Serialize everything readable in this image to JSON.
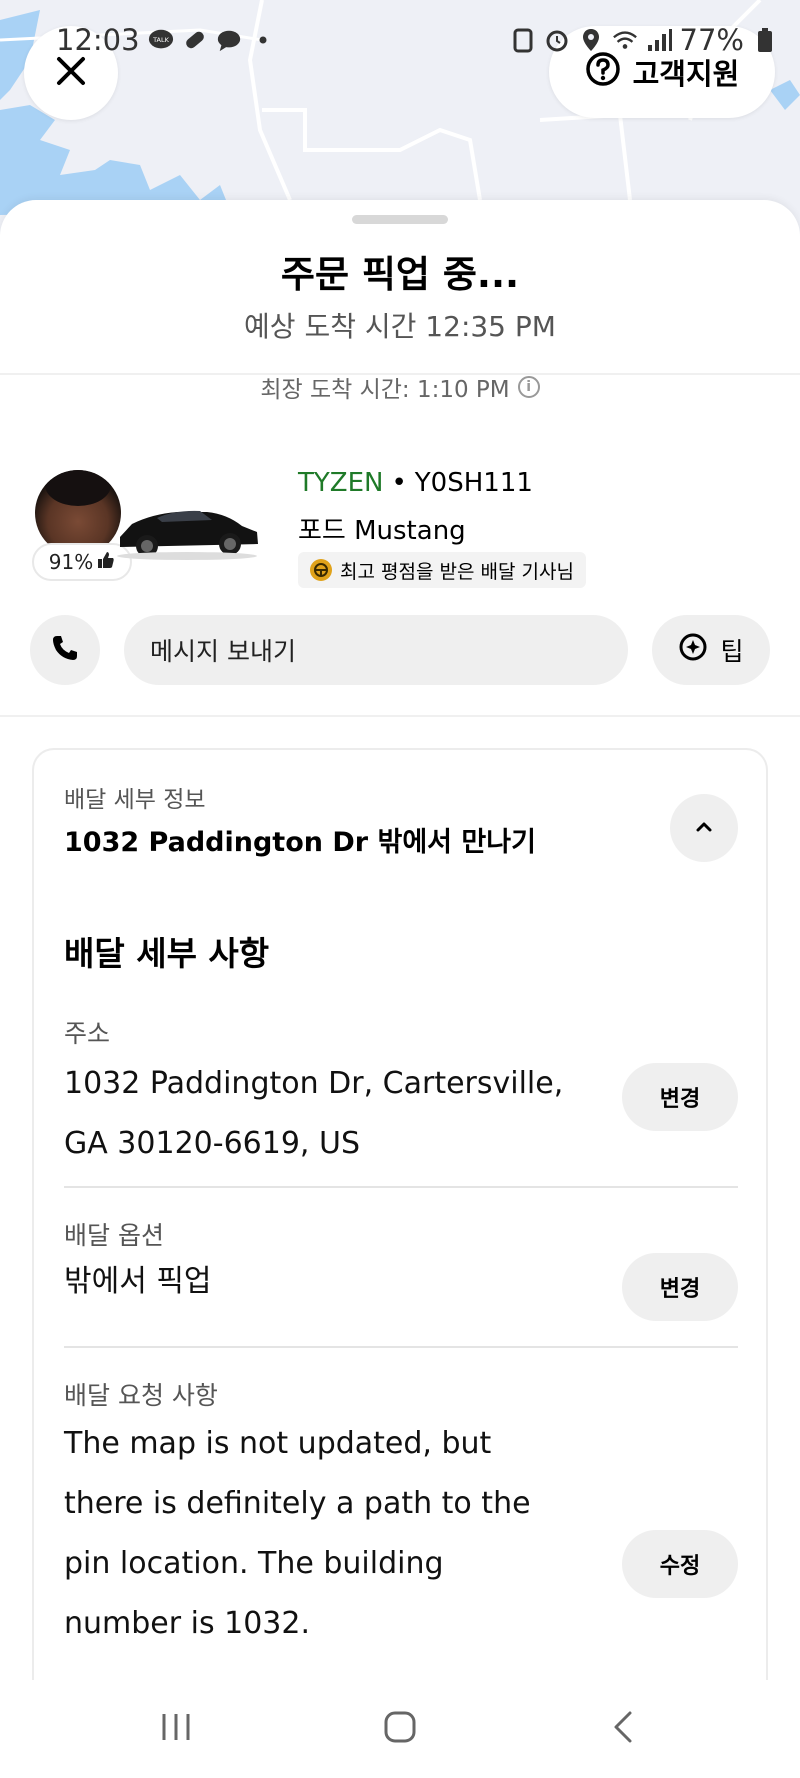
{
  "status_bar": {
    "time": "12:03",
    "battery": "77%",
    "talk_badge": "TALK"
  },
  "header": {
    "support_label": "고객지원"
  },
  "order": {
    "title": "주문 픽업 중...",
    "eta": "예상 도착 시간 12:35 PM",
    "latest_arrival": "최장 도착 시간: 1:10 PM"
  },
  "driver": {
    "name": "TYZEN",
    "separator": "•",
    "plate": "Y0SH111",
    "car_model": "포드 Mustang",
    "rating": "91%",
    "badge": "최고 평점을 받은 배달 기사님"
  },
  "actions": {
    "message_label": "메시지 보내기",
    "tip_label": "팁"
  },
  "delivery_card": {
    "header_label": "배달 세부 정보",
    "summary": "1032 Paddington Dr 밖에서 만나기",
    "section_title": "배달 세부 사항",
    "address_label": "주소",
    "address_line1": "1032 Paddington Dr, Cartersville,",
    "address_line2": "GA 30120-6619, US",
    "address_button": "변경",
    "option_label": "배달 옵션",
    "option_value": "밖에서 픽업",
    "option_button": "변경",
    "request_label": "배달 요청 사항",
    "request_lines": [
      "The map is not updated, but",
      "there is definitely a path to the",
      "pin location. The building",
      "number is 1032."
    ],
    "request_button": "수정"
  },
  "colors": {
    "driver_name": "#1f7a28",
    "map_water": "#a9d2f5",
    "map_bg": "#eef0f6",
    "badge_icon": "#e0a21a"
  },
  "icons": [
    "close-icon",
    "help-icon",
    "phone-icon",
    "tip-icon",
    "thumbs-up-icon",
    "chevron-up-icon",
    "info-icon",
    "steering-wheel-icon",
    "nav-recents-icon",
    "nav-home-icon",
    "nav-back-icon"
  ]
}
